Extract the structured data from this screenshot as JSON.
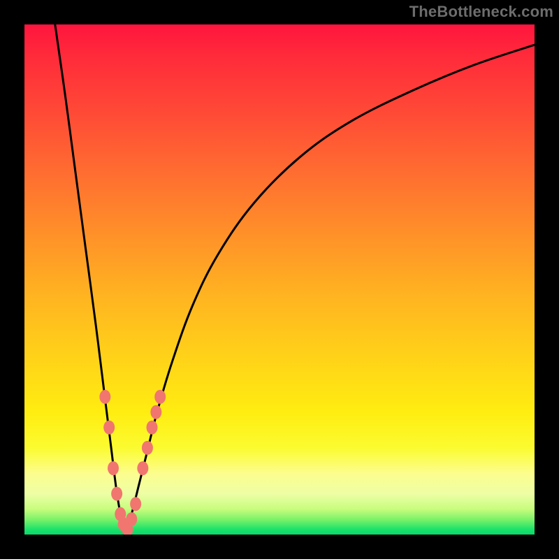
{
  "watermark": {
    "text": "TheBottleneck.com"
  },
  "chart_data": {
    "type": "line",
    "title": "",
    "xlabel": "",
    "ylabel": "",
    "xlim": [
      0,
      100
    ],
    "ylim": [
      0,
      100
    ],
    "legend": false,
    "grid": false,
    "background_gradient": [
      {
        "pos": 0,
        "color": "#ff153e"
      },
      {
        "pos": 50,
        "color": "#ffb620"
      },
      {
        "pos": 80,
        "color": "#fcfd8e"
      },
      {
        "pos": 100,
        "color": "#06d96c"
      }
    ],
    "series": [
      {
        "name": "bottleneck-curve-left",
        "x": [
          6.0,
          8.0,
          10.0,
          12.0,
          14.0,
          16.0,
          17.0,
          18.0,
          19.0,
          19.8
        ],
        "values": [
          100,
          86,
          71,
          56,
          41,
          25,
          17,
          9,
          3,
          0
        ]
      },
      {
        "name": "bottleneck-curve-right",
        "x": [
          19.8,
          21.0,
          22.5,
          24.0,
          26.0,
          29.0,
          33.0,
          38.0,
          45.0,
          54.0,
          64.0,
          76.0,
          88.0,
          100.0
        ],
        "values": [
          0,
          4,
          10,
          16,
          24,
          34,
          45,
          55,
          65,
          74,
          81,
          87,
          92,
          96
        ]
      }
    ],
    "markers": {
      "name": "highlighted-points",
      "color": "#f0766f",
      "points": [
        {
          "x": 15.8,
          "y": 27
        },
        {
          "x": 16.6,
          "y": 21
        },
        {
          "x": 17.4,
          "y": 13
        },
        {
          "x": 18.1,
          "y": 8
        },
        {
          "x": 18.8,
          "y": 4
        },
        {
          "x": 19.4,
          "y": 2
        },
        {
          "x": 20.2,
          "y": 1
        },
        {
          "x": 21.0,
          "y": 3
        },
        {
          "x": 21.8,
          "y": 6
        },
        {
          "x": 23.2,
          "y": 13
        },
        {
          "x": 24.1,
          "y": 17
        },
        {
          "x": 25.0,
          "y": 21
        },
        {
          "x": 25.8,
          "y": 24
        },
        {
          "x": 26.6,
          "y": 27
        }
      ]
    }
  }
}
